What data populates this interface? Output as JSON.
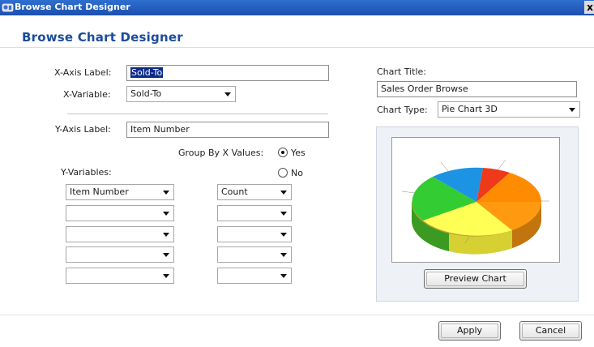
{
  "window": {
    "title": "Browse Chart Designer",
    "close_glyph": "x"
  },
  "heading": "Browse Chart Designer",
  "x_axis": {
    "label_caption": "X-Axis Label:",
    "value": "Sold-To"
  },
  "x_variable": {
    "caption": "X-Variable:",
    "value": "Sold-To"
  },
  "y_axis": {
    "label_caption": "Y-Axis Label:",
    "value": "Item Number"
  },
  "group_by": {
    "caption": "Group By X Values:",
    "yes_label": "Yes",
    "no_label": "No",
    "selected": "Yes"
  },
  "y_variables": {
    "caption": "Y-Variables:",
    "rows": [
      {
        "variable": "Item Number",
        "aggregate": "Count"
      },
      {
        "variable": "",
        "aggregate": ""
      },
      {
        "variable": "",
        "aggregate": ""
      },
      {
        "variable": "",
        "aggregate": ""
      },
      {
        "variable": "",
        "aggregate": ""
      }
    ]
  },
  "chart_title": {
    "caption": "Chart Title:",
    "value": "Sales Order Browse"
  },
  "chart_type": {
    "caption": "Chart Type:",
    "value": "Pie Chart 3D"
  },
  "preview_button": "Preview Chart",
  "apply_button": "Apply",
  "cancel_button": "Cancel",
  "colors": {
    "titlebar": "#1b4fae",
    "heading": "#1b4c9a",
    "selection": "#0b2a8a"
  },
  "icons": {
    "app": "chart-app-icon",
    "close": "close-icon",
    "dropdown": "chevron-down-icon"
  }
}
